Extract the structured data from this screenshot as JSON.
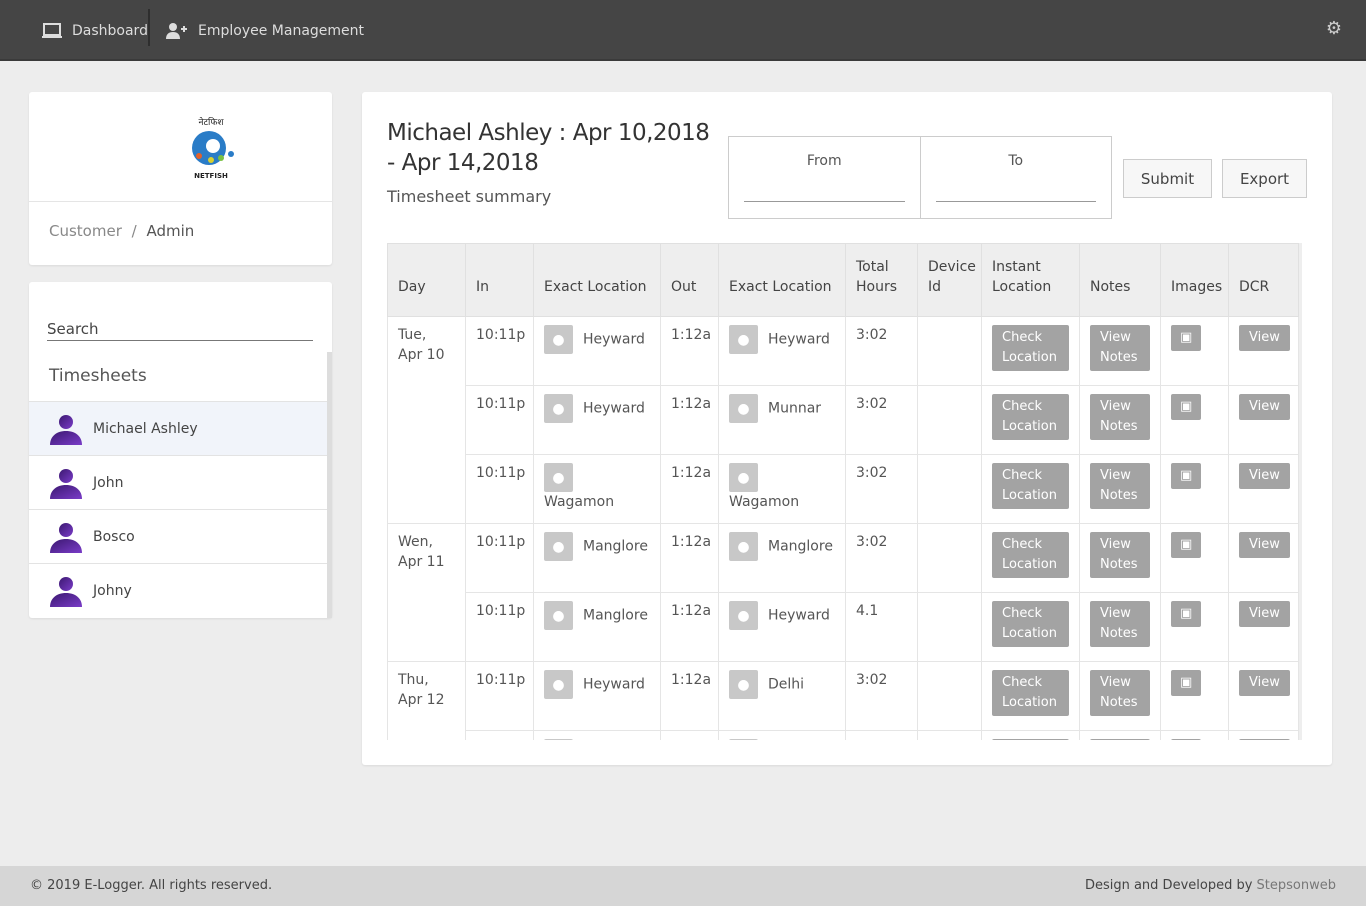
{
  "nav": {
    "dashboard": "Dashboard",
    "employee_management": "Employee Management"
  },
  "logo": {
    "text": "NETFISH",
    "hindi": "नेटफिश"
  },
  "breadcrumb": {
    "parent": "Customer",
    "separator": "/",
    "current": "Admin"
  },
  "sidebar": {
    "search_placeholder": "Search",
    "heading": "Timesheets",
    "users": [
      {
        "name": "Michael Ashley",
        "selected": true
      },
      {
        "name": "John"
      },
      {
        "name": "Bosco"
      },
      {
        "name": "Johny"
      }
    ]
  },
  "main": {
    "title": "Michael Ashley : Apr 10,2018 - Apr 14,2018",
    "subtitle": "Timesheet summary",
    "from_label": "From",
    "to_label": "To",
    "submit": "Submit",
    "export": "Export"
  },
  "table": {
    "headers": [
      "Day",
      "In",
      "Exact Location",
      "Out",
      "Exact Location",
      "Total Hours",
      "Device Id",
      "Instant Location",
      "Notes",
      "Images",
      "DCR"
    ],
    "check_label": "Check Location",
    "notes_label": "View Notes",
    "dcr_label": "View",
    "groups": [
      {
        "day": "Tue, Apr 10",
        "rows": [
          {
            "in": "10:11p",
            "in_loc": "Heyward",
            "out": "1:12a",
            "out_loc": "Heyward",
            "total": "3:02",
            "device": ""
          },
          {
            "in": "10:11p",
            "in_loc": "Heyward",
            "out": "1:12a",
            "out_loc": "Munnar",
            "total": "3:02",
            "device": ""
          },
          {
            "in": "10:11p",
            "in_loc": "Wagamon",
            "out": "1:12a",
            "out_loc": "Wagamon",
            "total": "3:02",
            "device": ""
          }
        ]
      },
      {
        "day": "Wen, Apr 11",
        "rows": [
          {
            "in": "10:11p",
            "in_loc": "Manglore",
            "out": "1:12a",
            "out_loc": "Manglore",
            "total": "3:02",
            "device": ""
          },
          {
            "in": "10:11p",
            "in_loc": "Manglore",
            "out": "1:12a",
            "out_loc": "Heyward",
            "total": "4.1",
            "device": ""
          }
        ]
      },
      {
        "day": "Thu, Apr 12",
        "rows": [
          {
            "in": "10:11p",
            "in_loc": "Heyward",
            "out": "1:12a",
            "out_loc": "Delhi",
            "total": "3:02",
            "device": ""
          },
          {
            "in": "",
            "in_loc": "",
            "out": "",
            "out_loc": "",
            "total": "",
            "device": ""
          }
        ]
      }
    ]
  },
  "footer": {
    "copyright": "© 2019 E-Logger. All rights reserved.",
    "credit": "Design and Developed by",
    "company": "Stepsonweb"
  }
}
